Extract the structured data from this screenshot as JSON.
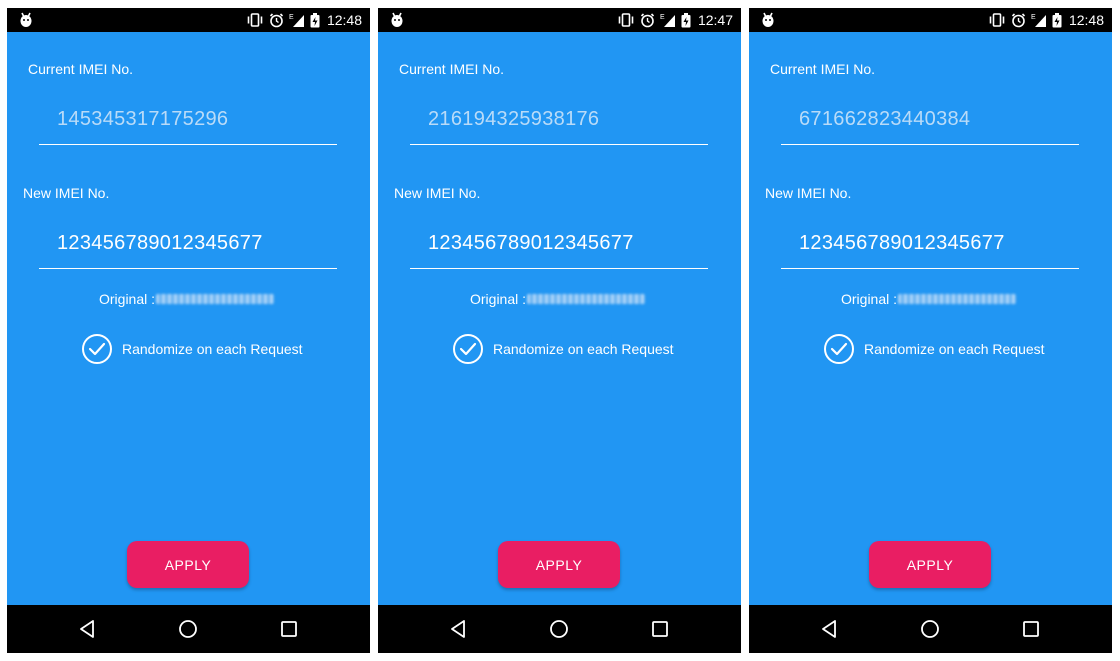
{
  "colors": {
    "background": "#2196F3",
    "button": "#E91E63",
    "bars": "#000000",
    "current_value": "#B9DBF8"
  },
  "status_icons": [
    "app-icon",
    "vibrate-icon",
    "alarm-icon",
    "signal-icon",
    "battery-icon"
  ],
  "nav_icons": [
    "back-icon",
    "home-icon",
    "recent-apps-icon"
  ],
  "screens": [
    {
      "time": "12:48",
      "current_label": "Current IMEI No.",
      "current_imei": "145345317175296",
      "new_label": "New IMEI No.",
      "new_imei": "123456789012345677",
      "original_label": "Original :",
      "randomize_label": "Randomize on each Request",
      "randomize_checked": true,
      "apply_label": "APPLY",
      "network_badge": "E"
    },
    {
      "time": "12:47",
      "current_label": "Current IMEI No.",
      "current_imei": "216194325938176",
      "new_label": "New IMEI No.",
      "new_imei": "123456789012345677",
      "original_label": "Original :",
      "randomize_label": "Randomize on each Request",
      "randomize_checked": true,
      "apply_label": "APPLY",
      "network_badge": "E"
    },
    {
      "time": "12:48",
      "current_label": "Current IMEI No.",
      "current_imei": "671662823440384",
      "new_label": "New IMEI No.",
      "new_imei": "123456789012345677",
      "original_label": "Original :",
      "randomize_label": "Randomize on each Request",
      "randomize_checked": true,
      "apply_label": "APPLY",
      "network_badge": "E"
    }
  ]
}
